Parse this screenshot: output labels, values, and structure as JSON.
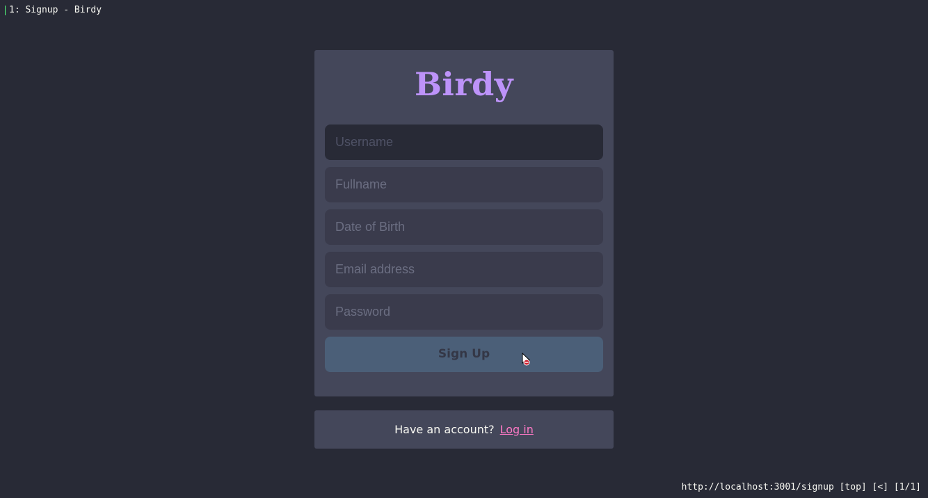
{
  "tab": {
    "title": "1: Signup - Birdy"
  },
  "app": {
    "logo": "Birdy"
  },
  "form": {
    "username_placeholder": "Username",
    "fullname_placeholder": "Fullname",
    "dob_placeholder": "Date of Birth",
    "email_placeholder": "Email address",
    "password_placeholder": "Password",
    "submit_label": "Sign Up"
  },
  "login": {
    "prompt": "Have an account?",
    "link_label": "Log in"
  },
  "status": {
    "text": "http://localhost:3001/signup [top] [<] [1/1]"
  },
  "colors": {
    "background": "#282a36",
    "card": "#44475a",
    "logo": "#bd93f9",
    "link": "#ff79c6",
    "button": "#4b5f78"
  },
  "icons": {
    "cursor": "not-allowed-cursor-icon"
  }
}
